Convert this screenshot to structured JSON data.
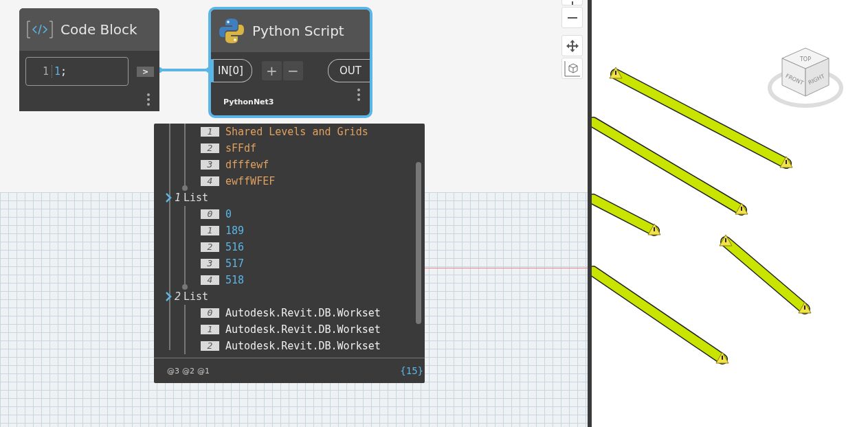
{
  "code_block": {
    "title": "Code Block",
    "line_number": "1",
    "code": [
      {
        "text": "1",
        "kind": "number"
      },
      {
        "text": ";",
        "kind": "punct"
      }
    ],
    "output_port": ">"
  },
  "python_node": {
    "title": "Python Script",
    "selected": true,
    "inputs": [
      "IN[0]"
    ],
    "add": "+",
    "remove": "−",
    "output": "OUT",
    "engine": "PythonNet3"
  },
  "preview": {
    "groups": [
      {
        "items": [
          {
            "index": "1",
            "value": "Shared Levels and Grids",
            "kind": "string"
          },
          {
            "index": "2",
            "value": "sFFdf",
            "kind": "string"
          },
          {
            "index": "3",
            "value": "dfffewf",
            "kind": "string"
          },
          {
            "index": "4",
            "value": "ewffWFEF",
            "kind": "string"
          }
        ]
      },
      {
        "index": "1",
        "label": "List",
        "items": [
          {
            "index": "0",
            "value": "0",
            "kind": "number"
          },
          {
            "index": "1",
            "value": "189",
            "kind": "number"
          },
          {
            "index": "2",
            "value": "516",
            "kind": "number"
          },
          {
            "index": "3",
            "value": "517",
            "kind": "number"
          },
          {
            "index": "4",
            "value": "518",
            "kind": "number"
          }
        ]
      },
      {
        "index": "2",
        "label": "List",
        "items": [
          {
            "index": "0",
            "value": "Autodesk.Revit.DB.Workset",
            "kind": "object"
          },
          {
            "index": "1",
            "value": "Autodesk.Revit.DB.Workset",
            "kind": "object"
          },
          {
            "index": "2",
            "value": "Autodesk.Revit.DB.Workset",
            "kind": "object"
          }
        ]
      }
    ],
    "levels": [
      "@3",
      "@2",
      "@1"
    ],
    "count": "{15}"
  },
  "view_cube": {
    "faces": [
      "TOP",
      "FRONT",
      "RIGHT"
    ]
  }
}
